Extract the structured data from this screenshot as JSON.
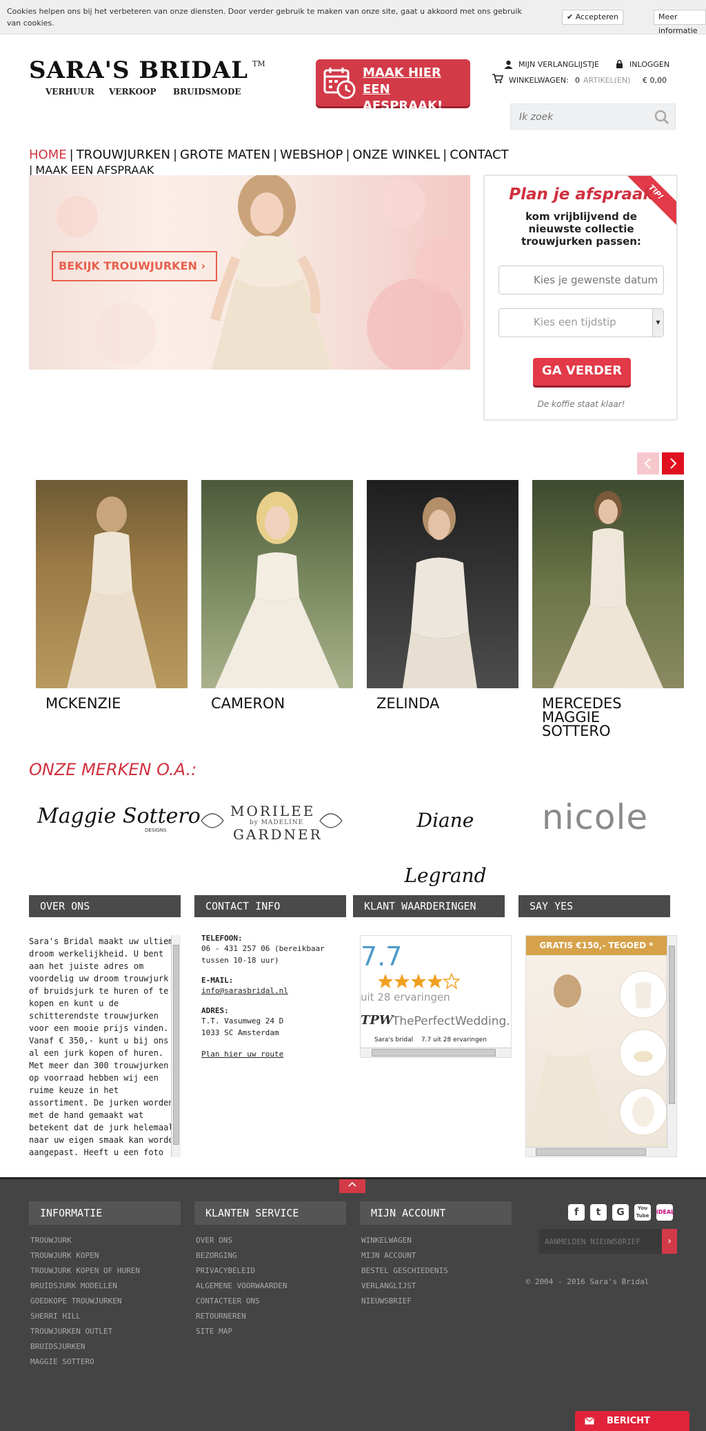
{
  "cookie": {
    "text": "Cookies helpen ons bij het verbeteren van onze diensten. Door verder gebruik te maken van onze site, gaat u akkoord met ons gebruik van cookies.",
    "accept": "✔ Accepteren",
    "more": "Meer informatie"
  },
  "header": {
    "logo": "SARA'S BRIDAL",
    "logo_tm": "TM",
    "logo_sub": [
      "VERHUUR",
      "VERKOOP",
      "BRUIDSMODE"
    ],
    "appointment": "MAAK HIER EEN AFSPRAAK!",
    "wishlist": "MIJN VERLANGLIJSTJE",
    "login": "INLOGGEN",
    "cart_label": "WINKELWAGEN:",
    "cart_count": "0",
    "cart_items": "ARTIKEL(EN)",
    "cart_total": "€ 0,00",
    "search_placeholder": "Ik zoek"
  },
  "nav": {
    "items": [
      "HOME",
      "TROUWJURKEN",
      "GROTE MATEN",
      "WEBSHOP",
      "ONZE WINKEL",
      "CONTACT",
      "MAAK EEN AFSPRAAK"
    ]
  },
  "hero": {
    "button": "BEKIJK TROUWJURKEN"
  },
  "plan": {
    "title": "Plan je afspraak",
    "subtitle": "kom vrijblijvend de nieuwste collectie trouwjurken passen:",
    "date_placeholder": "Kies je gewenste datum",
    "time_placeholder": "Kies een tijdstip",
    "submit": "GA VERDER",
    "coffee": "De koffie staat klaar!",
    "ribbon": "TIP!"
  },
  "dresses": [
    {
      "name": "MCKENZIE"
    },
    {
      "name": "CAMERON"
    },
    {
      "name": "ZELINDA"
    },
    {
      "name": "MERCEDES MAGGIE SOTTERO"
    }
  ],
  "brands": {
    "title": "ONZE MERKEN O.A.:",
    "items": [
      "Maggie Sottero",
      "MORILEE",
      "by MADELINE",
      "GARDNER",
      "Diane Legrand",
      "nicole",
      "DESIGNS"
    ]
  },
  "info": {
    "about_title": "OVER ONS",
    "about_text": "Sara's Bridal maakt uw ultieme droom werkelijkheid. U bent aan het juiste adres om voordelig uw droom trouwjurk of bruidsjurk te huren of te kopen en kunt u de schitterendste trouwjurken voor een mooie prijs vinden. Vanaf € 350,- kunt u bij ons al een jurk kopen of huren. Met meer dan 300 trouwjurken op voorraad hebben wij een ruime keuze in het assortiment. De jurken worden met de hand gemaakt wat betekent dat de jurk helemaal naar uw eigen smaak kan worden aangepast. Heeft u een foto van uw ideale droomjurk? In dit geval kan de",
    "contact_title": "CONTACT INFO",
    "phone_label": "TELEFOON:",
    "phone": "06 - 431 257 06  (bereikbaar tussen 10-18 uur)",
    "email_label": "E-MAIL:",
    "email": "info@sarasbridal.nl",
    "address_label": "ADRES:",
    "address_1": "T.T. Vasumweg 24 D",
    "address_2": "1033 SC  Amsterdam",
    "route": "Plan hier uw route",
    "reviews_title": "KLANT WAARDERINGEN",
    "score": "7.7",
    "stars": 4,
    "reviews_count": "uit 28 ervaringen",
    "tpw": "ThePerfectWedding.nl",
    "tpw_footer": "Sara's bridal",
    "tpw_footer_2": "7.7 uit 28 ervaringen",
    "sayyes_title": "SAY YES",
    "sayyes_banner": "GRATIS €150,- TEGOED *"
  },
  "footer": {
    "informatie_title": "INFORMATIE",
    "informatie": [
      "TROUWJURK",
      "TROUWJURK KOPEN",
      "TROUWJURK KOPEN OF HUREN",
      "BRUIDSJURK MODELLEN",
      "GOEDKOPE TROUWJURKEN",
      "SHERRI HILL",
      "TROUWJURKEN OUTLET",
      "BRUIDSJURKEN",
      "MAGGIE SOTTERO"
    ],
    "service_title": "KLANTEN SERVICE",
    "service": [
      "OVER ONS",
      "BEZORGING",
      "PRIVACYBELEID",
      "ALGEMENE VOORWAARDEN",
      "CONTACTEER ONS",
      "RETOURNEREN",
      "SITE MAP"
    ],
    "account_title": "MIJN ACCOUNT",
    "account": [
      "WINKELWAGEN",
      "MIJN ACCOUNT",
      "BESTEL GESCHIEDENIS",
      "VERLANGLIJST",
      "NIEUWSBRIEF"
    ],
    "social": [
      "f",
      "t",
      "G",
      "You Tube",
      "iDEAL"
    ],
    "newsletter": "AANMELDEN NIEUWSBRIEF",
    "copyright": "©  2004 - 2016  Sara's Bridal",
    "message": "BERICHT STUREN"
  },
  "colors": {
    "accent": "#d0303f",
    "footer": "#444444",
    "coral": "#e8604e"
  }
}
